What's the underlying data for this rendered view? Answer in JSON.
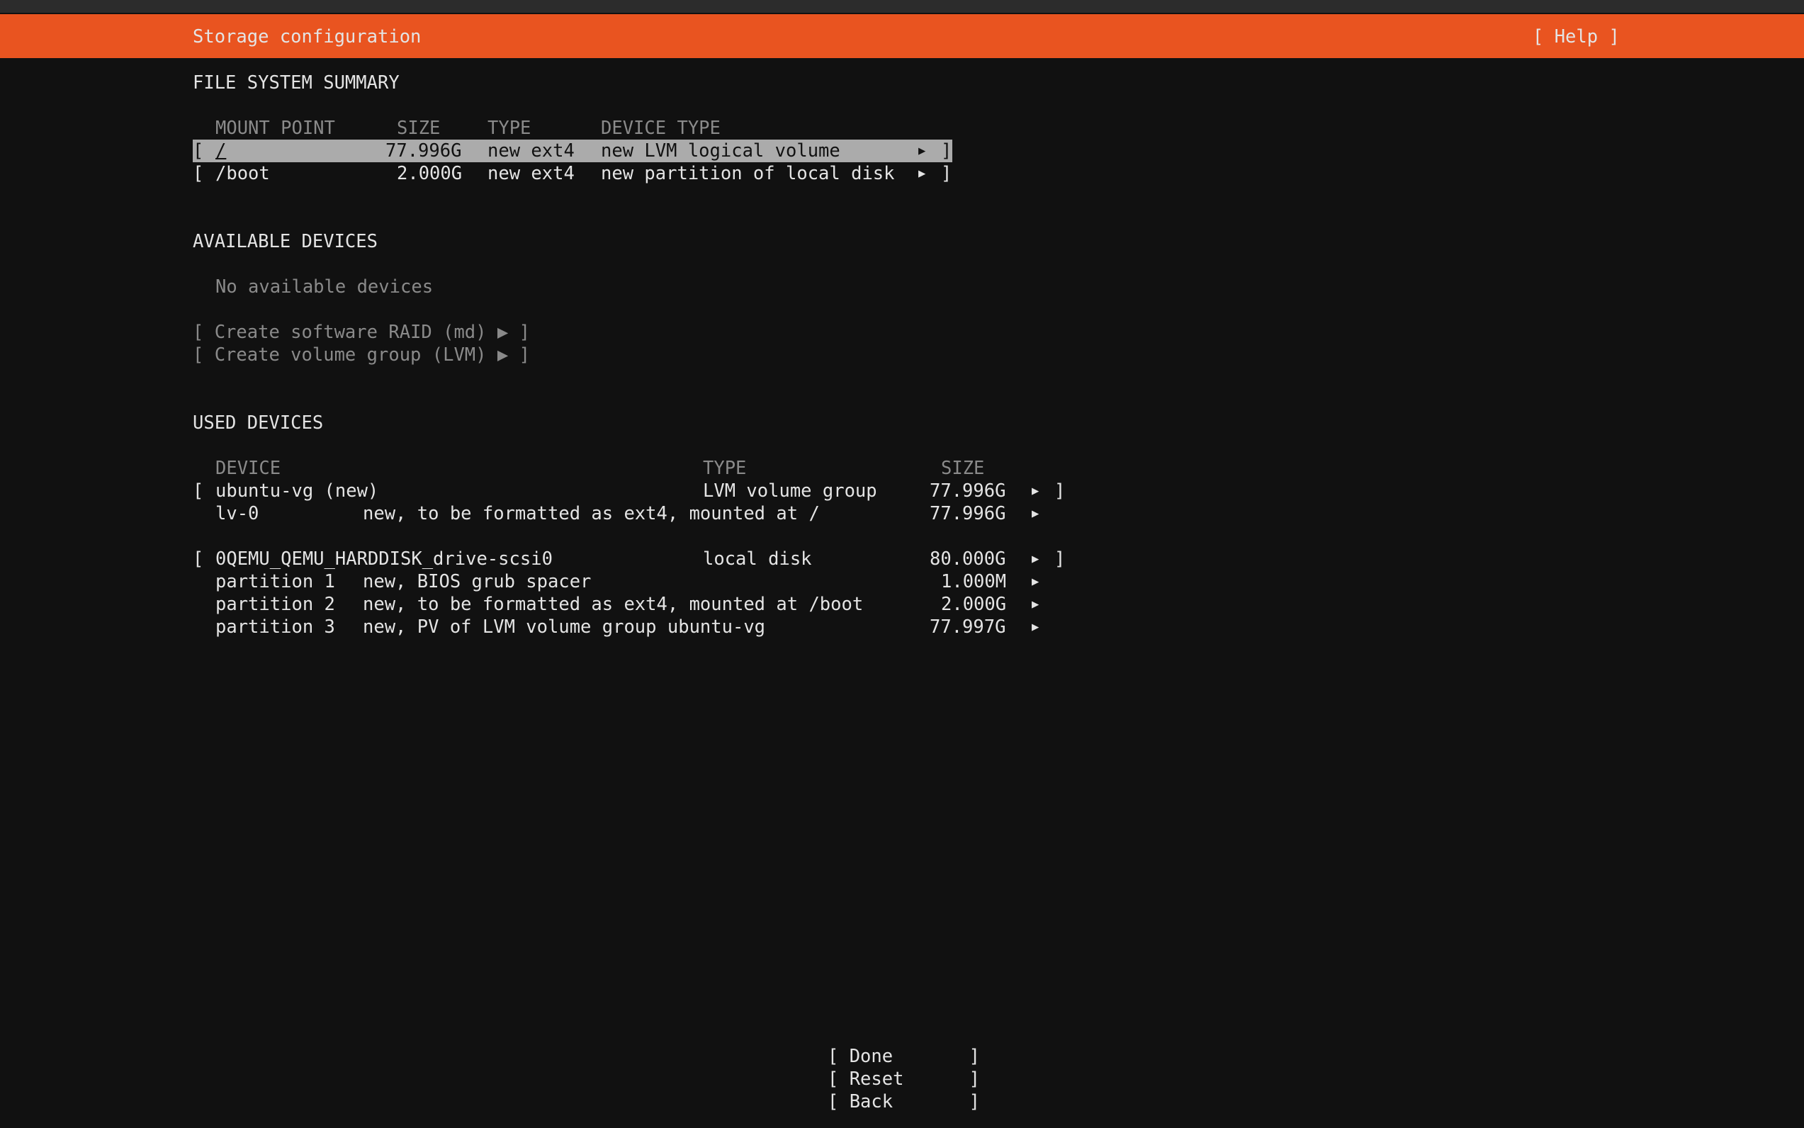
{
  "header": {
    "title": "Storage configuration",
    "help_label": "[ Help ]",
    "color": "#e95420"
  },
  "fs_summary": {
    "heading": "FILE SYSTEM SUMMARY",
    "columns": {
      "mount_point": "MOUNT POINT",
      "size": "SIZE",
      "type": "TYPE",
      "device_type": "DEVICE TYPE"
    },
    "rows": [
      {
        "open": "[",
        "mount": "/",
        "size": "77.996G",
        "type": "new ext4",
        "device_type": "new LVM logical volume",
        "arrow": "▶",
        "close": "]"
      },
      {
        "open": "[",
        "mount": "/boot",
        "size": "2.000G",
        "type": "new ext4",
        "device_type": "new partition of local disk",
        "arrow": "▶",
        "close": "]"
      }
    ]
  },
  "available": {
    "heading": "AVAILABLE DEVICES",
    "empty_text": "No available devices",
    "create_raid": "[ Create software RAID (md) ▶ ]",
    "create_vg": "[ Create volume group (LVM) ▶ ]"
  },
  "used": {
    "heading": "USED DEVICES",
    "columns": {
      "device": "DEVICE",
      "type": "TYPE",
      "size": "SIZE"
    },
    "groups": [
      {
        "open": "[",
        "name": "ubuntu-vg (new)",
        "type": "LVM volume group",
        "size": "77.996G",
        "arrow": "▶",
        "close": "]",
        "children": [
          {
            "name": "lv-0",
            "desc": "new, to be formatted as ext4, mounted at /",
            "size": "77.996G",
            "arrow": "▶"
          }
        ]
      },
      {
        "open": "[",
        "name": "0QEMU_QEMU_HARDDISK_drive-scsi0",
        "type": "local disk",
        "size": "80.000G",
        "arrow": "▶",
        "close": "]",
        "children": [
          {
            "name": "partition 1",
            "desc": "new, BIOS grub spacer",
            "size": "1.000M",
            "arrow": "▶"
          },
          {
            "name": "partition 2",
            "desc": "new, to be formatted as ext4, mounted at /boot",
            "size": "2.000G",
            "arrow": "▶"
          },
          {
            "name": "partition 3",
            "desc": "new, PV of LVM volume group ubuntu-vg",
            "size": "77.997G",
            "arrow": "▶"
          }
        ]
      }
    ]
  },
  "buttons": {
    "done": "[ Done       ]",
    "reset": "[ Reset      ]",
    "back": "[ Back       ]"
  }
}
